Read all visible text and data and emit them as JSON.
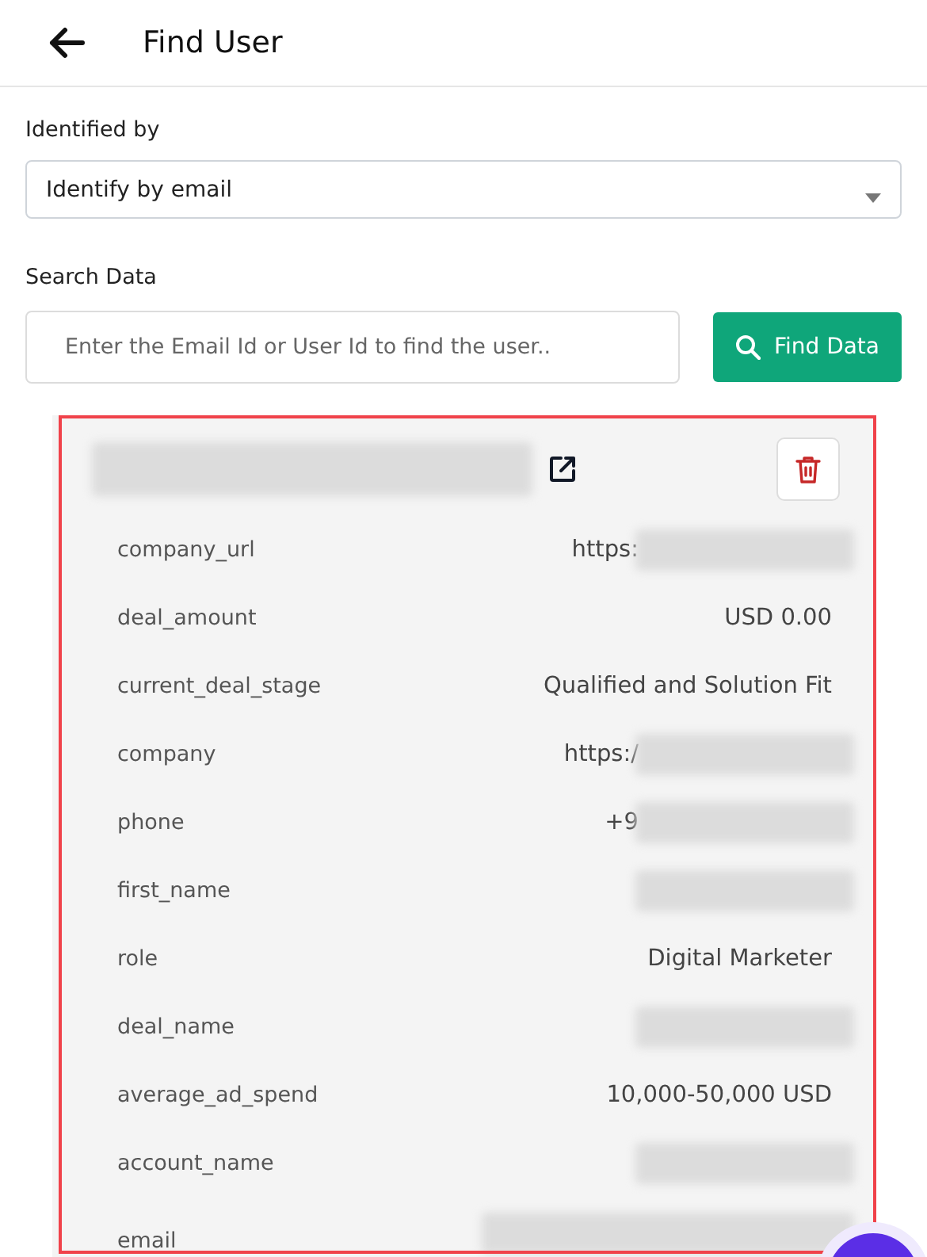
{
  "header": {
    "title": "Find User"
  },
  "identified_by": {
    "label": "Identified by",
    "value": "Identify by email"
  },
  "search": {
    "label": "Search Data",
    "placeholder": "Enter the Email Id or User Id to find the user..",
    "button": "Find Data"
  },
  "result_card": {
    "highlighted": true,
    "title_redacted": true,
    "rows": [
      {
        "label": "company_url",
        "value": "https:",
        "redacted": true
      },
      {
        "label": "deal_amount",
        "value": "USD 0.00",
        "redacted": false
      },
      {
        "label": "current_deal_stage",
        "value": "Qualified and Solution Fit",
        "redacted": false
      },
      {
        "label": "company",
        "value": "https:/",
        "redacted": true
      },
      {
        "label": "phone",
        "value": "+9",
        "redacted": true
      },
      {
        "label": "first_name",
        "redacted": true
      },
      {
        "label": "role",
        "value": "Digital Marketer",
        "redacted": false
      },
      {
        "label": "deal_name",
        "redacted": true
      },
      {
        "label": "average_ad_spend",
        "value": "10,000-50,000 USD",
        "redacted": false
      },
      {
        "label": "account_name",
        "redacted": true
      },
      {
        "label": "email",
        "redacted": true
      }
    ]
  }
}
